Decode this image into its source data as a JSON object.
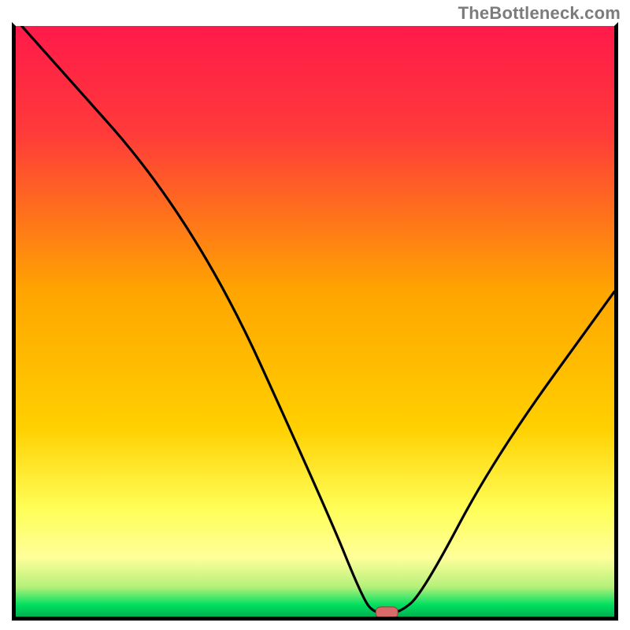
{
  "watermark": {
    "text": "TheBottleneck.com"
  },
  "colors": {
    "top": "#ff1a4a",
    "mid": "#ffd000",
    "low_yellow": "#ffff8a",
    "green": "#00e060",
    "green_deep": "#00b050",
    "curve": "#000000",
    "marker_fill": "#d86a6a",
    "marker_stroke": "#a03838",
    "frame": "#000000"
  },
  "chart_data": {
    "type": "line",
    "title": "",
    "xlabel": "",
    "ylabel": "",
    "xlim": [
      0,
      100
    ],
    "ylim": [
      0,
      100
    ],
    "curve": [
      {
        "x": 1,
        "y": 100
      },
      {
        "x": 30,
        "y": 67
      },
      {
        "x": 52,
        "y": 18
      },
      {
        "x": 58,
        "y": 3
      },
      {
        "x": 60,
        "y": 0.5
      },
      {
        "x": 64,
        "y": 0.5
      },
      {
        "x": 68,
        "y": 4
      },
      {
        "x": 80,
        "y": 27
      },
      {
        "x": 100,
        "y": 55
      }
    ],
    "marker": {
      "x": 62,
      "y": 0.7
    },
    "gradient_stops": [
      {
        "offset": 0,
        "color": "#ff1a4a"
      },
      {
        "offset": 18,
        "color": "#ff3a3a"
      },
      {
        "offset": 45,
        "color": "#ffa500"
      },
      {
        "offset": 68,
        "color": "#ffd000"
      },
      {
        "offset": 82,
        "color": "#ffff5a"
      },
      {
        "offset": 90,
        "color": "#ffff9a"
      },
      {
        "offset": 95,
        "color": "#b4f07a"
      },
      {
        "offset": 98,
        "color": "#00e060"
      },
      {
        "offset": 100,
        "color": "#00b050"
      }
    ]
  }
}
